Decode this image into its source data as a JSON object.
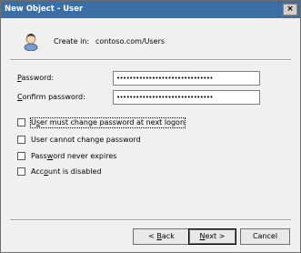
{
  "window": {
    "title": "New Object - User",
    "close_glyph": "×"
  },
  "header": {
    "create_in_label": "Create in:",
    "create_in_value": "contoso.com/Users",
    "icon": "user-icon"
  },
  "fields": {
    "password": {
      "label_underline": "P",
      "label_rest": "assword:",
      "value": "••••••••••••••••••••••••••••••"
    },
    "confirm": {
      "label_underline": "C",
      "label_rest": "onfirm password:",
      "value": "••••••••••••••••••••••••••••••"
    }
  },
  "options": [
    {
      "pre": "U",
      "u": "s",
      "post": "er must change password at next logon",
      "checked": false
    },
    {
      "pre": "User cannot change password",
      "u": "",
      "post": "",
      "checked": false
    },
    {
      "pre": "Pass",
      "u": "w",
      "post": "ord never expires",
      "checked": false
    },
    {
      "pre": "Acc",
      "u": "o",
      "post": "unt is disabled",
      "checked": false
    }
  ],
  "buttons": {
    "back": {
      "pre": "< ",
      "u": "B",
      "post": "ack"
    },
    "next": {
      "pre": "",
      "u": "N",
      "post": "ext >"
    },
    "cancel": {
      "label": "Cancel"
    }
  }
}
